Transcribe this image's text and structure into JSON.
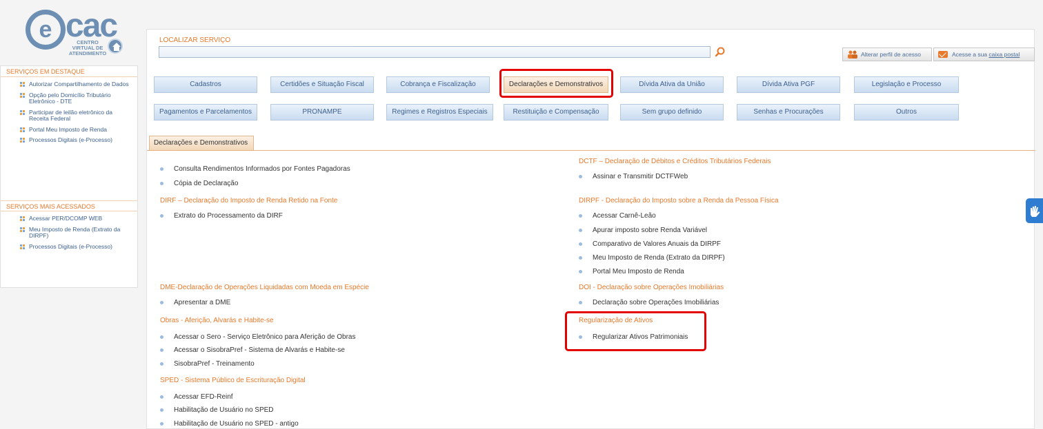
{
  "header": {
    "logo_text": "cac",
    "logo_sub": "CENTRO VIRTUAL DE ATENDIMENTO",
    "search_label": "LOCALIZAR SERVIÇO",
    "search_value": "",
    "perfil_label": "Alterar perfil de acesso",
    "caixa_prefix": "Acesse a sua ",
    "caixa_link": "caixa postal"
  },
  "sidebar": {
    "destaque_title": "SERVIÇOS EM DESTAQUE",
    "destaque_items": [
      "Autorizar Compartilhamento de Dados",
      "Opção pelo Domicílio Tributário Eletrônico - DTE",
      "Participar de leilão eletrônico da Receita Federal",
      "Portal Meu Imposto de Renda",
      "Processos Digitais (e-Processo)"
    ],
    "acessados_title": "SERVIÇOS MAIS ACESSADOS",
    "acessados_items": [
      "Acessar PER/DCOMP WEB",
      "Meu Imposto de Renda (Extrato da DIRPF)",
      "Processos Digitais (e-Processo)"
    ]
  },
  "categories": {
    "row1": [
      "Cadastros",
      "Certidões e Situação Fiscal",
      "Cobrança e Fiscalização",
      "Declarações e Demonstrativos",
      "Dívida Ativa da União",
      "Dívida Ativa PGF",
      "Legislação e Processo"
    ],
    "row2": [
      "Pagamentos e Parcelamentos",
      "PRONAMPE",
      "Regimes e Registros Especiais",
      "Restituição e Compensação",
      "Sem grupo definido",
      "Senhas e Procurações",
      "Outros"
    ],
    "active": "Declarações e Demonstrativos"
  },
  "tab_label": "Declarações e Demonstrativos",
  "left_col": {
    "top_items": [
      "Consulta Rendimentos Informados por Fontes Pagadoras",
      "Cópia de Declaração"
    ],
    "dirf_title": "DIRF – Declaração do Imposto de Renda Retido na Fonte",
    "dirf_items": [
      "Extrato do Processamento da DIRF"
    ],
    "dme_title": "DME-Declaração de Operações Liquidadas com Moeda em Espécie",
    "dme_items": [
      "Apresentar a DME"
    ],
    "obras_title": "Obras - Aferição, Alvarás e Habite-se",
    "obras_items": [
      "Acessar o Sero - Serviço Eletrônico para Aferição de Obras",
      "Acessar o SisobraPref - Sistema de Alvarás e Habite-se",
      "SisobraPref - Treinamento"
    ],
    "sped_title": "SPED - Sistema Público de Escrituração Digital",
    "sped_items": [
      "Acessar EFD-Reinf",
      "Habilitação de Usuário no SPED",
      "Habilitação de Usuário no SPED - antigo"
    ]
  },
  "right_col": {
    "dctf_title": "DCTF – Declaração de Débitos e Créditos Tributários Federais",
    "dctf_items": [
      "Assinar e Transmitir DCTFWeb"
    ],
    "dirpf_title": "DIRPF - Declaração do Imposto sobre a Renda da Pessoa Física",
    "dirpf_items": [
      "Acessar Carnê-Leão",
      "Apurar imposto sobre Renda Variável",
      "Comparativo de Valores Anuais da DIRPF",
      "Meu Imposto de Renda (Extrato da DIRPF)",
      "Portal Meu Imposto de Renda"
    ],
    "doi_title": "DOI - Declaração sobre Operações Imobiliárias",
    "doi_items": [
      "Declaração sobre Operações Imobiliárias"
    ],
    "reg_title": "Regularização de Ativos",
    "reg_items": [
      "Regularizar Ativos Patrimoniais"
    ]
  },
  "colors": {
    "accent_orange": "#e8792b",
    "link_blue": "#3b5f8e",
    "highlight_red": "#e30000"
  }
}
